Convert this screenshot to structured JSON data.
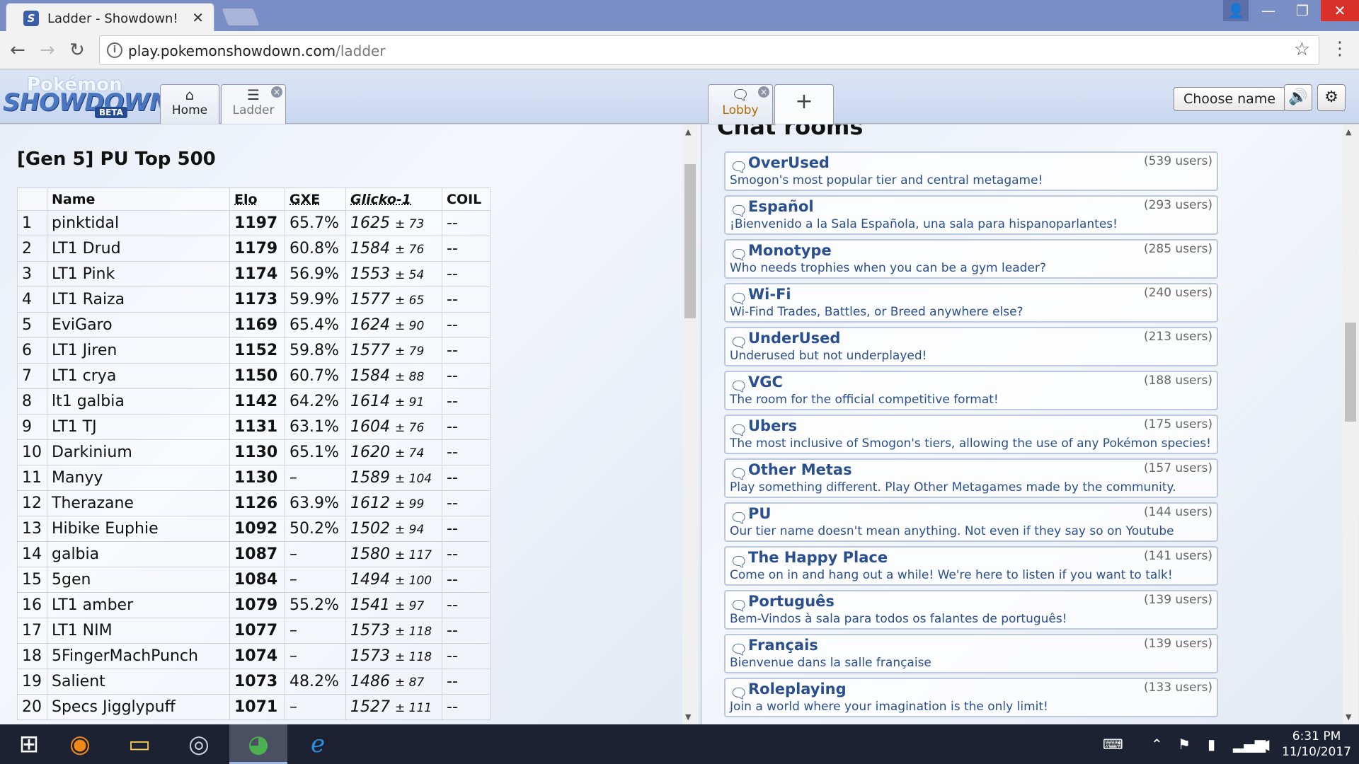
{
  "browser": {
    "tab_title": "Ladder - Showdown!",
    "favicon": "S",
    "tab_close": "✕",
    "url_host": "play.pokemonshowdown.com",
    "url_path": "/ladder",
    "icons": {
      "back": "←",
      "forward": "→",
      "reload": "↻",
      "info": "i",
      "star": "☆",
      "menu": "⋮"
    },
    "window": {
      "user": "👤",
      "minimize": "—",
      "maximize": "❐",
      "close": "✕"
    }
  },
  "header": {
    "logo_top": "Pokémon",
    "logo_main": "SHOWDOWN",
    "logo_badge": "BETA",
    "tabs": {
      "home": {
        "icon": "⌂",
        "label": "Home"
      },
      "ladder": {
        "icon": "☰",
        "label": "Ladder",
        "close": "×"
      },
      "lobby": {
        "icon": "🗨",
        "label": "Lobby",
        "close": "×"
      },
      "plus": {
        "icon": "+"
      }
    },
    "choose_name": "Choose name",
    "sound_icon": "🔊",
    "gear_icon": "⚙"
  },
  "ladder": {
    "title": "[Gen 5] PU Top 500",
    "columns": {
      "rank": "",
      "name": "Name",
      "elo": "Elo",
      "gxe": "GXE",
      "glicko": "Glicko-1",
      "coil": "COIL"
    },
    "rows": [
      {
        "rank": "1",
        "name": "pinktidal",
        "elo": "1197",
        "gxe": "65.7%",
        "glicko": "1625",
        "dev": "± 73",
        "coil": "--"
      },
      {
        "rank": "2",
        "name": "LT1 Drud",
        "elo": "1179",
        "gxe": "60.8%",
        "glicko": "1584",
        "dev": "± 76",
        "coil": "--"
      },
      {
        "rank": "3",
        "name": "LT1 Pink",
        "elo": "1174",
        "gxe": "56.9%",
        "glicko": "1553",
        "dev": "± 54",
        "coil": "--"
      },
      {
        "rank": "4",
        "name": "LT1 Raiza",
        "elo": "1173",
        "gxe": "59.9%",
        "glicko": "1577",
        "dev": "± 65",
        "coil": "--"
      },
      {
        "rank": "5",
        "name": "EviGaro",
        "elo": "1169",
        "gxe": "65.4%",
        "glicko": "1624",
        "dev": "± 90",
        "coil": "--"
      },
      {
        "rank": "6",
        "name": "LT1 Jiren",
        "elo": "1152",
        "gxe": "59.8%",
        "glicko": "1577",
        "dev": "± 79",
        "coil": "--"
      },
      {
        "rank": "7",
        "name": "LT1 crya",
        "elo": "1150",
        "gxe": "60.7%",
        "glicko": "1584",
        "dev": "± 88",
        "coil": "--"
      },
      {
        "rank": "8",
        "name": "lt1 galbia",
        "elo": "1142",
        "gxe": "64.2%",
        "glicko": "1614",
        "dev": "± 91",
        "coil": "--"
      },
      {
        "rank": "9",
        "name": "LT1 TJ",
        "elo": "1131",
        "gxe": "63.1%",
        "glicko": "1604",
        "dev": "± 76",
        "coil": "--"
      },
      {
        "rank": "10",
        "name": "Darkinium",
        "elo": "1130",
        "gxe": "65.1%",
        "glicko": "1620",
        "dev": "± 74",
        "coil": "--"
      },
      {
        "rank": "11",
        "name": "Manyy",
        "elo": "1130",
        "gxe": "–",
        "glicko": "1589",
        "dev": "± 104",
        "coil": "--"
      },
      {
        "rank": "12",
        "name": "Therazane",
        "elo": "1126",
        "gxe": "63.9%",
        "glicko": "1612",
        "dev": "± 99",
        "coil": "--"
      },
      {
        "rank": "13",
        "name": "Hibike Euphie",
        "elo": "1092",
        "gxe": "50.2%",
        "glicko": "1502",
        "dev": "± 94",
        "coil": "--"
      },
      {
        "rank": "14",
        "name": "galbia",
        "elo": "1087",
        "gxe": "–",
        "glicko": "1580",
        "dev": "± 117",
        "coil": "--"
      },
      {
        "rank": "15",
        "name": "5gen",
        "elo": "1084",
        "gxe": "–",
        "glicko": "1494",
        "dev": "± 100",
        "coil": "--"
      },
      {
        "rank": "16",
        "name": "LT1 amber",
        "elo": "1079",
        "gxe": "55.2%",
        "glicko": "1541",
        "dev": "± 97",
        "coil": "--"
      },
      {
        "rank": "17",
        "name": "LT1 NIM",
        "elo": "1077",
        "gxe": "–",
        "glicko": "1573",
        "dev": "± 118",
        "coil": "--"
      },
      {
        "rank": "18",
        "name": "5FingerMachPunch",
        "elo": "1074",
        "gxe": "–",
        "glicko": "1573",
        "dev": "± 118",
        "coil": "--"
      },
      {
        "rank": "19",
        "name": "Salient",
        "elo": "1073",
        "gxe": "48.2%",
        "glicko": "1486",
        "dev": "± 87",
        "coil": "--"
      },
      {
        "rank": "20",
        "name": "Specs Jigglypuff",
        "elo": "1071",
        "gxe": "–",
        "glicko": "1527",
        "dev": "± 111",
        "coil": "--"
      }
    ]
  },
  "rooms": {
    "title": "Chat rooms",
    "bubble_icon": "🗨",
    "items": [
      {
        "name": "OverUsed",
        "users": "(539 users)",
        "desc": "Smogon's most popular tier and central metagame!"
      },
      {
        "name": "Español",
        "users": "(293 users)",
        "desc": "¡Bienvenido a la Sala Española, una sala para hispanoparlantes!"
      },
      {
        "name": "Monotype",
        "users": "(285 users)",
        "desc": "Who needs trophies when you can be a gym leader?"
      },
      {
        "name": "Wi-Fi",
        "users": "(240 users)",
        "desc": "Wi-Find Trades, Battles, or Breed anywhere else?"
      },
      {
        "name": "UnderUsed",
        "users": "(213 users)",
        "desc": "Underused but not underplayed!"
      },
      {
        "name": "VGC",
        "users": "(188 users)",
        "desc": "The room for the official competitive format!"
      },
      {
        "name": "Ubers",
        "users": "(175 users)",
        "desc": "The most inclusive of Smogon's tiers, allowing the use of any Pokémon species!"
      },
      {
        "name": "Other Metas",
        "users": "(157 users)",
        "desc": "Play something different. Play Other Metagames made by the community."
      },
      {
        "name": "PU",
        "users": "(144 users)",
        "desc": "Our tier name doesn't mean anything. Not even if they say so on Youtube"
      },
      {
        "name": "The Happy Place",
        "users": "(141 users)",
        "desc": "Come on in and hang out a while! We're here to listen if you want to talk!"
      },
      {
        "name": "Português",
        "users": "(139 users)",
        "desc": "Bem-Vindos à sala para todos os falantes de português!"
      },
      {
        "name": "Français",
        "users": "(139 users)",
        "desc": "Bienvenue dans la salle française"
      },
      {
        "name": "Roleplaying",
        "users": "(133 users)",
        "desc": "Join a world where your imagination is the only limit!"
      }
    ]
  },
  "taskbar": {
    "apps": {
      "start": "⊞",
      "firefox": "◉",
      "explorer": "▭",
      "steam": "◎",
      "chrome": "◕",
      "ie": "ℯ"
    },
    "tray": {
      "keyboard": "⌨",
      "up": "⌃",
      "flag": "⚑",
      "battery": "▮",
      "signal": "▂▄▆",
      "volume": "◀"
    },
    "time": "6:31 PM",
    "date": "11/10/2017"
  },
  "colors": {
    "accent": "#2a4f8e",
    "titlebar": "#7a8ec6",
    "taskbar": "#1c2231"
  }
}
